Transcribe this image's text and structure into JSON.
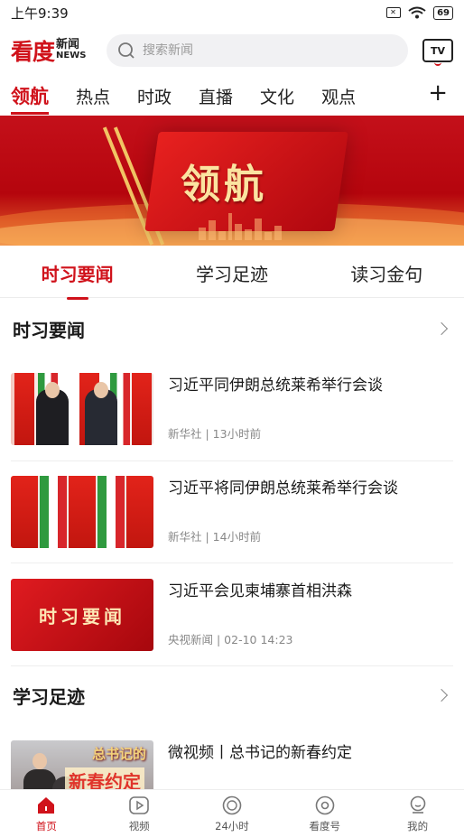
{
  "status": {
    "time": "上午9:39",
    "battery": "69"
  },
  "header": {
    "logo_zh": "看度",
    "logo_en_top": "新闻",
    "logo_en_bottom": "NEWS",
    "search_placeholder": "搜索新闻",
    "tv_label": "TV"
  },
  "channels": [
    "领航",
    "热点",
    "时政",
    "直播",
    "文化",
    "观点"
  ],
  "channel_active": 0,
  "banner": {
    "title": "领航"
  },
  "subtabs": [
    "时习要闻",
    "学习足迹",
    "读习金句"
  ],
  "sections": [
    {
      "title": "时习要闻",
      "items": [
        {
          "title": "习近平同伊朗总统莱希举行会谈",
          "meta": "新华社 | 13小时前"
        },
        {
          "title": "习近平将同伊朗总统莱希举行会谈",
          "meta": "新华社 | 14小时前"
        },
        {
          "title": "习近平会见柬埔寨首相洪森",
          "meta": "央视新闻 | 02-10 14:23",
          "thumb_text": "时习要闻"
        }
      ]
    },
    {
      "title": "学习足迹",
      "items": [
        {
          "title": "微视频丨总书记的新春约定",
          "thumb_caption_top": "总书记的",
          "thumb_caption_main": "新春约定"
        }
      ]
    }
  ],
  "bottom_nav": [
    "首页",
    "视频",
    "24小时",
    "看度号",
    "我的"
  ],
  "colors": {
    "brand_red": "#d0121b"
  }
}
